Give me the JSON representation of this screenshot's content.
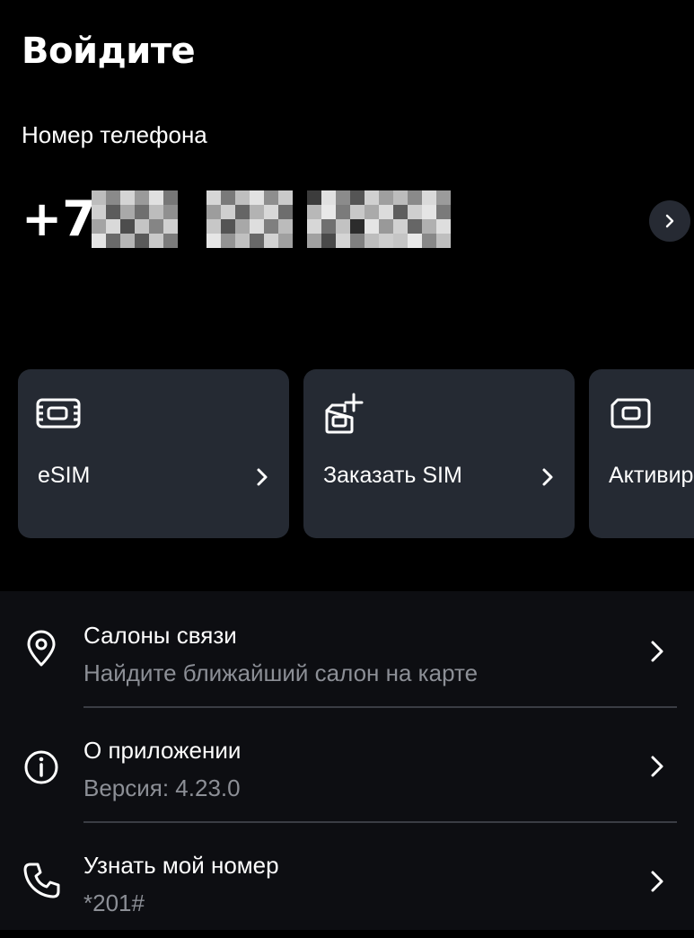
{
  "header": {
    "title": "Войдите"
  },
  "phone": {
    "label": "Номер телефона",
    "prefix": "+7",
    "next_icon": "chevron-right-icon"
  },
  "cards": [
    {
      "label": "eSIM",
      "icon": "esim-chip-icon"
    },
    {
      "label": "Заказать SIM",
      "icon": "sim-add-icon"
    },
    {
      "label": "Активир",
      "icon": "sim-card-icon"
    }
  ],
  "list": [
    {
      "title": "Салоны связи",
      "subtitle": "Найдите ближайший салон на карте",
      "icon": "location-pin-icon"
    },
    {
      "title": "О приложении",
      "subtitle": "Версия: 4.23.0",
      "icon": "info-icon"
    },
    {
      "title": "Узнать мой номер",
      "subtitle": "*201#",
      "icon": "phone-icon"
    }
  ],
  "colors": {
    "background": "#000000",
    "card": "#252a33",
    "panel": "#0d0e12",
    "muted_text": "#8c8f96"
  }
}
